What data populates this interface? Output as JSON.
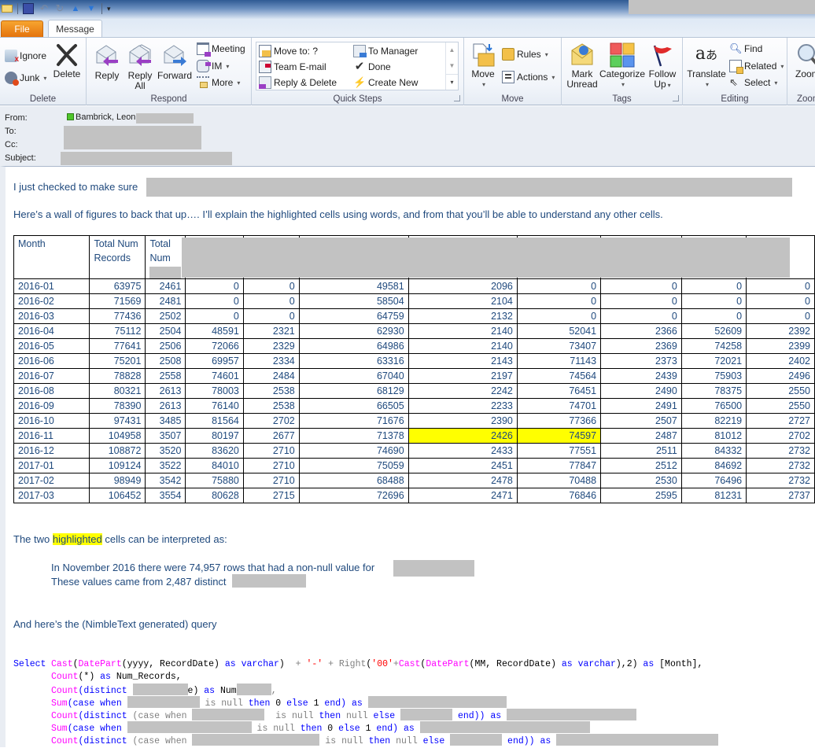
{
  "window": {
    "quick_access": [
      "mail-icon",
      "save-icon",
      "undo-icon",
      "redo-icon",
      "previous-item-icon",
      "next-item-icon",
      "customize-qat-icon"
    ]
  },
  "tabs": [
    {
      "label": "File",
      "active": false
    },
    {
      "label": "Message",
      "active": true
    }
  ],
  "ribbon": {
    "delete_group": {
      "label": "Delete",
      "ignore": "Ignore",
      "junk": "Junk",
      "delete": "Delete"
    },
    "respond_group": {
      "label": "Respond",
      "reply": "Reply",
      "reply_all_1": "Reply",
      "reply_all_2": "All",
      "forward": "Forward",
      "meeting": "Meeting",
      "im": "IM",
      "more": "More"
    },
    "quick_steps_group": {
      "label": "Quick Steps",
      "items": [
        "Move to: ?",
        "Team E-mail",
        "Reply & Delete",
        "To Manager",
        "Done",
        "Create New"
      ]
    },
    "move_group": {
      "label": "Move",
      "move": "Move",
      "rules": "Rules",
      "actions": "Actions"
    },
    "tags_group": {
      "label": "Tags",
      "mark_unread_1": "Mark",
      "mark_unread_2": "Unread",
      "categorize": "Categorize",
      "follow_up_1": "Follow",
      "follow_up_2": "Up"
    },
    "editing_group": {
      "label": "Editing",
      "translate": "Translate",
      "find": "Find",
      "related": "Related",
      "select": "Select"
    },
    "zoom_group": {
      "label": "Zoom",
      "zoom": "Zoom"
    }
  },
  "header": {
    "from_label": "From:",
    "from_value": "Bambrick, Leon",
    "to_label": "To:",
    "cc_label": "Cc:",
    "subject_label": "Subject:"
  },
  "body": {
    "intro": "I just checked to make sure",
    "wall": "Here’s a wall of figures to back that up…. I’ll explain the highlighted cells using words, and from that you’ll be able to understand any other cells.",
    "interp_pre": "The two ",
    "interp_hl": "highlighted",
    "interp_post": " cells can be interpreted as:",
    "line1": "In November 2016 there were 74,957 rows that had a non-null value for",
    "line2": "These values came from 2,487 distinct",
    "query_intro": "And here’s the (NimbleText generated) query"
  },
  "table": {
    "headers": [
      "Month",
      "Total Num Records",
      "Total Num"
    ],
    "highlight_color": "#ffff00",
    "highlight": {
      "row": 10,
      "cols": [
        6,
        7
      ]
    },
    "rows": [
      [
        "2016-01",
        "63975",
        "2461",
        "0",
        "0",
        "49581",
        "2096",
        "0",
        "0",
        "0",
        "0"
      ],
      [
        "2016-02",
        "71569",
        "2481",
        "0",
        "0",
        "58504",
        "2104",
        "0",
        "0",
        "0",
        "0"
      ],
      [
        "2016-03",
        "77436",
        "2502",
        "0",
        "0",
        "64759",
        "2132",
        "0",
        "0",
        "0",
        "0"
      ],
      [
        "2016-04",
        "75112",
        "2504",
        "48591",
        "2321",
        "62930",
        "2140",
        "52041",
        "2366",
        "52609",
        "2392"
      ],
      [
        "2016-05",
        "77641",
        "2506",
        "72066",
        "2329",
        "64986",
        "2140",
        "73407",
        "2369",
        "74258",
        "2399"
      ],
      [
        "2016-06",
        "75201",
        "2508",
        "69957",
        "2334",
        "63316",
        "2143",
        "71143",
        "2373",
        "72021",
        "2402"
      ],
      [
        "2016-07",
        "78828",
        "2558",
        "74601",
        "2484",
        "67040",
        "2197",
        "74564",
        "2439",
        "75903",
        "2496"
      ],
      [
        "2016-08",
        "80321",
        "2613",
        "78003",
        "2538",
        "68129",
        "2242",
        "76451",
        "2490",
        "78375",
        "2550"
      ],
      [
        "2016-09",
        "78390",
        "2613",
        "76140",
        "2538",
        "66505",
        "2233",
        "74701",
        "2491",
        "76500",
        "2550"
      ],
      [
        "2016-10",
        "97431",
        "3485",
        "81564",
        "2702",
        "71676",
        "2390",
        "77366",
        "2507",
        "82219",
        "2727"
      ],
      [
        "2016-11",
        "104958",
        "3507",
        "80197",
        "2677",
        "71378",
        "2426",
        "74597",
        "2487",
        "81012",
        "2702"
      ],
      [
        "2016-12",
        "108872",
        "3520",
        "83620",
        "2710",
        "74690",
        "2433",
        "77551",
        "2511",
        "84332",
        "2732"
      ],
      [
        "2017-01",
        "109124",
        "3522",
        "84010",
        "2710",
        "75059",
        "2451",
        "77847",
        "2512",
        "84692",
        "2732"
      ],
      [
        "2017-02",
        "98949",
        "3542",
        "75880",
        "2710",
        "68488",
        "2478",
        "70488",
        "2530",
        "76496",
        "2732"
      ],
      [
        "2017-03",
        "106452",
        "3554",
        "80628",
        "2715",
        "72696",
        "2471",
        "76846",
        "2595",
        "81231",
        "2737"
      ]
    ]
  },
  "query": {
    "select": "Select",
    "line1": {
      "cast": "Cast",
      "datepart": "DatePart",
      "args": "(yyyy, RecordDate)",
      "as": "as",
      "varchar": "varchar",
      "plus1": "+",
      "dash": "'-'",
      "plus2": "+",
      "right": "Right",
      "zero": "'00'",
      "plus3": "+",
      "cast2": "Cast",
      "datepart2": "DatePart",
      "args2": "(MM, RecordDate)",
      "as2": "as",
      "varchar2": "varchar",
      "tail": "),2)",
      "as3": "as",
      "alias": "[Month],"
    },
    "line2": {
      "fn": "Count",
      "args": "(*)",
      "as": "as",
      "alias": "Num_Records,"
    },
    "line3": {
      "fn": "Count",
      "open": "(distinct",
      "close": "e)",
      "as": "as",
      "alias": "Num",
      "comma": ","
    },
    "sum_line": {
      "fn": "Sum",
      "case": "(case when",
      "isnull": "is null",
      "then": "then",
      "zero": "0",
      "else": "else",
      "one": "1",
      "end": "end)",
      "as": "as"
    },
    "count_line": {
      "fn": "Count",
      "open": "(distinct",
      "case": "(case when",
      "isnull": "is null",
      "then": "then",
      "null": "null",
      "else": "else",
      "end": "end))",
      "as": "as"
    }
  }
}
